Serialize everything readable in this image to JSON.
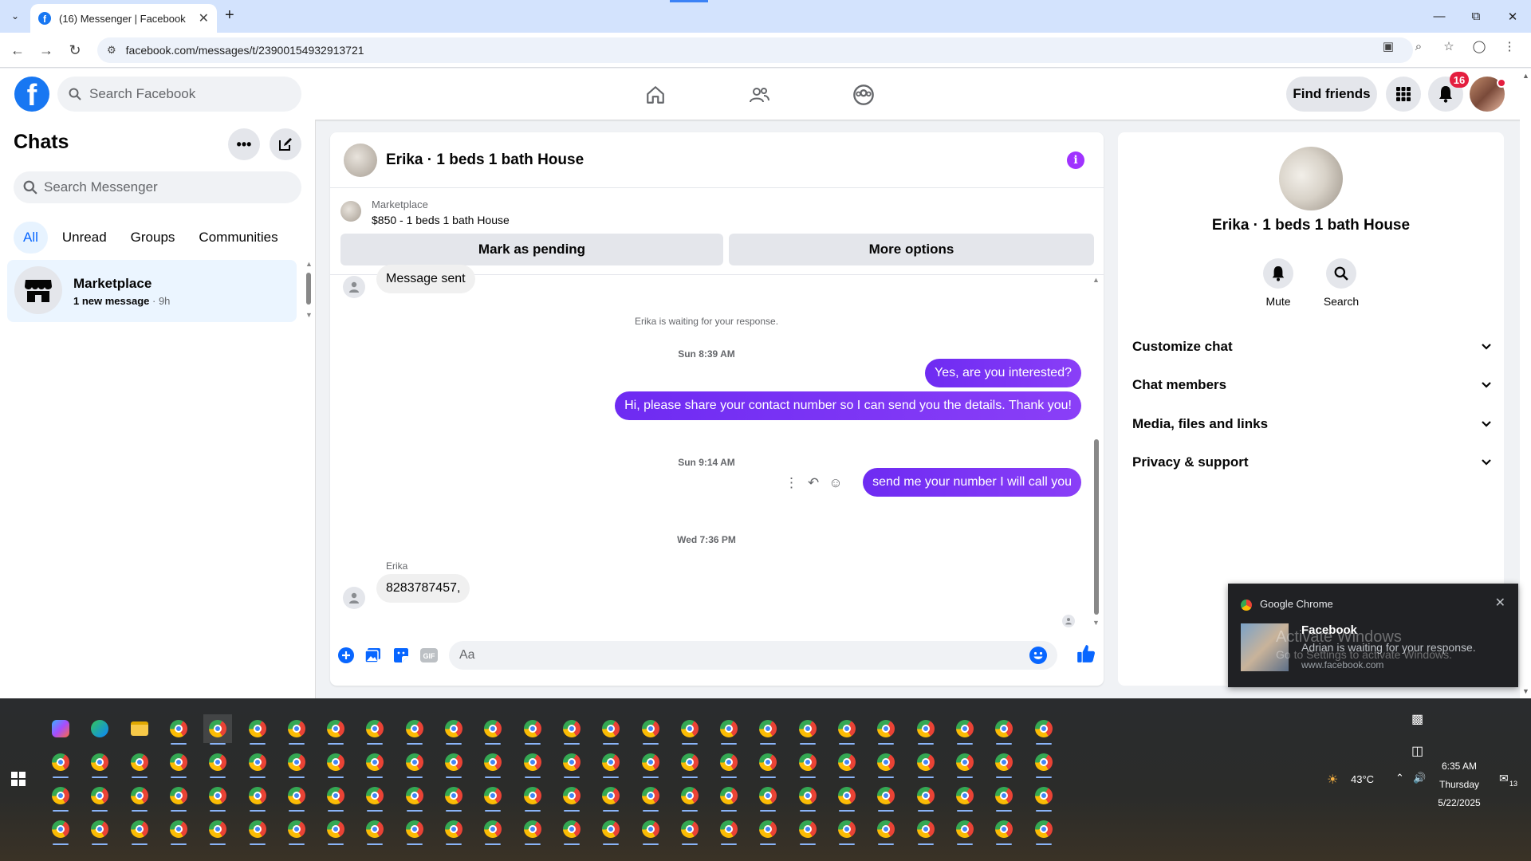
{
  "browser": {
    "tab_title": "(16) Messenger | Facebook",
    "url": "facebook.com/messages/t/23900154932913721"
  },
  "fb": {
    "search_placeholder": "Search Facebook",
    "find_friends": "Find friends",
    "notification_count": "16",
    "brand_color": "#1877f2"
  },
  "chats": {
    "title": "Chats",
    "search_placeholder": "Search Messenger",
    "filters": [
      "All",
      "Unread",
      "Groups",
      "Communities"
    ],
    "active_filter": "All",
    "items": [
      {
        "name": "Marketplace",
        "preview": "1 new message",
        "time": "9h"
      }
    ]
  },
  "conversation": {
    "title": "Erika · 1 beds 1 bath House",
    "marketplace_label": "Marketplace",
    "listing": "$850 - 1 beds 1 bath House",
    "mark_pending": "Mark as pending",
    "more_options": "More options",
    "messages": {
      "partial_first": "Message sent",
      "system_note": "Erika is waiting for your response.",
      "ts1": "Sun 8:39 AM",
      "out1": "Yes, are you interested?",
      "out2": "Hi, please share your contact number so I can send you the details. Thank you!",
      "ts2": "Sun 9:14 AM",
      "out3": "send me your number I will call you",
      "ts3": "Wed 7:36 PM",
      "sender": "Erika",
      "in1": "8283787457,"
    },
    "composer_placeholder": "Aa",
    "accent_color": "#7a2ef5"
  },
  "info_panel": {
    "name": "Erika · 1 beds 1 bath House",
    "actions": [
      "Mute",
      "Search"
    ],
    "sections": [
      "Customize chat",
      "Chat members",
      "Media, files and links",
      "Privacy & support"
    ]
  },
  "notification": {
    "app": "Google Chrome",
    "title": "Facebook",
    "body": "Adrian is waiting for your response.",
    "source": "www.facebook.com",
    "watermark_line1": "Activate Windows",
    "watermark_line2": "Go to Settings to activate Windows."
  },
  "taskbar": {
    "weather": "43°C",
    "time": "6:35 AM",
    "day": "Thursday",
    "date": "5/22/2025",
    "notif_count": "13"
  }
}
